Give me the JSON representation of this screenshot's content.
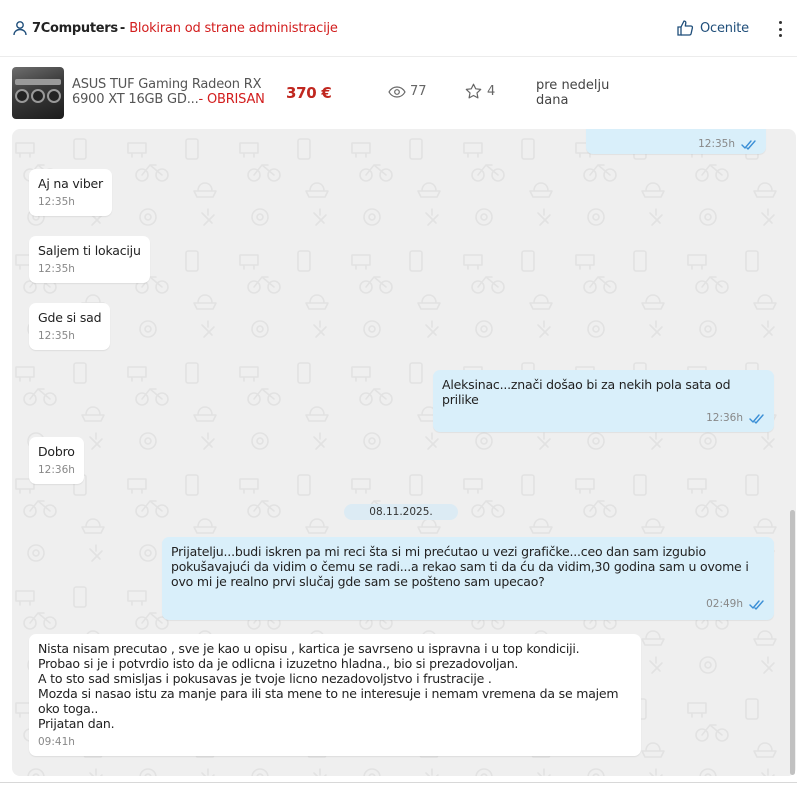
{
  "header": {
    "seller_name": "7Computers",
    "separator": "-",
    "status_text": "Blokiran od strane administracije",
    "rate_label": "Ocenite"
  },
  "product": {
    "title": "ASUS TUF Gaming Radeon RX 6900 XT 16GB GD...",
    "status_suffix": "- OBRISAN",
    "price": "370 €",
    "views": "77",
    "favorites": "4",
    "posted_ago": "pre nedelju dana"
  },
  "date_separator": "08.11.2025.",
  "messages": [
    {
      "id": "m0",
      "direction": "out",
      "text": "",
      "time": "12:35h"
    },
    {
      "id": "m1",
      "direction": "in",
      "text": "Aj na viber",
      "time": "12:35h"
    },
    {
      "id": "m2",
      "direction": "in",
      "text": "Saljem ti lokaciju",
      "time": "12:35h"
    },
    {
      "id": "m3",
      "direction": "in",
      "text": "Gde si sad",
      "time": "12:35h"
    },
    {
      "id": "m4",
      "direction": "out",
      "text": "Aleksinac...znači došao bi za nekih pola sata od prilike",
      "time": "12:36h"
    },
    {
      "id": "m5",
      "direction": "in",
      "text": "Dobro",
      "time": "12:36h"
    },
    {
      "id": "m6",
      "direction": "out",
      "text": "Prijatelju...budi iskren pa mi reci šta si mi prećutao u vezi grafičke...ceo dan sam izgubio pokušavajući da vidim o čemu se radi...a rekao sam ti da ću da vidim,30 godina sam u ovome i ovo mi je realno prvi slučaj gde sam se pošteno sam upecao?",
      "time": "02:49h"
    },
    {
      "id": "m7",
      "direction": "in",
      "text": "Nista nisam precutao , sve je kao u opisu , kartica je savrseno u ispravna i u top kondiciji.\nProbao si je i potvrdio isto da je odlicna i izuzetno hladna., bio si prezadovoljan.\nA to sto sad smisljas i pokusavas je tvoje licno nezadovoljstvo i frustracije .\nMozda si nasao istu za manje para ili sta mene to ne interesuje i nemam vremena da se majem oko toga..\nPrijatan dan.",
      "time": "09:41h"
    }
  ],
  "colors": {
    "accent_blue": "#1f4e7a",
    "status_red": "#d21d1d",
    "price_red": "#c0271f",
    "outgoing_bubble": "#d9effa",
    "incoming_bubble": "#ffffff",
    "chat_background": "#efefef",
    "read_ticks": "#3b8fd6"
  },
  "icons": {
    "user": "user-icon",
    "rate": "thumbs-up-icon",
    "menu": "kebab-menu-icon",
    "views": "eye-icon",
    "favorites": "star-icon",
    "read_receipt": "double-check-icon"
  }
}
